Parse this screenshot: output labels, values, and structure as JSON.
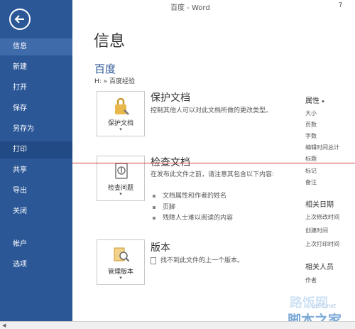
{
  "window": {
    "title": "百度 - Word",
    "help": "?"
  },
  "sidebar": {
    "items": [
      {
        "label": "信息"
      },
      {
        "label": "新建"
      },
      {
        "label": "打开"
      },
      {
        "label": "保存"
      },
      {
        "label": "另存为"
      },
      {
        "label": "打印"
      },
      {
        "label": "共享"
      },
      {
        "label": "导出"
      },
      {
        "label": "关闭"
      },
      {
        "label": "帐户"
      },
      {
        "label": "选项"
      }
    ]
  },
  "main": {
    "title": "信息",
    "doc_name": "百度",
    "path": "H: » 百度经验",
    "protect": {
      "button": "保护文档",
      "title": "保护文档",
      "desc": "控制其他人可以对此文档所做的更改类型。"
    },
    "inspect": {
      "button": "检查问题",
      "title": "检查文档",
      "desc": "在发布此文件之前，请注意其包含以下内容:",
      "bullets": [
        "文档属性和作者的姓名",
        "页脚",
        "残障人士难以阅读的内容"
      ]
    },
    "versions": {
      "button": "管理版本",
      "title": "版本",
      "desc": "找不到此文件的上一个版本。"
    }
  },
  "properties": {
    "heading": "属性",
    "items": [
      "大小",
      "页数",
      "字数",
      "编辑时间总计",
      "标题",
      "标记",
      "备注"
    ],
    "dates_heading": "相关日期",
    "dates": [
      "上次修改时间",
      "创建时间",
      "上次打印时间"
    ],
    "people_heading": "相关人员",
    "people": [
      "作者"
    ]
  },
  "watermark": {
    "line1": "路饭网",
    "url": "jb51.net",
    "line2": "脚本之家"
  },
  "colors": {
    "sidebar": "#2b5797",
    "accent": "#2b5797",
    "red_line": "#d04040"
  }
}
